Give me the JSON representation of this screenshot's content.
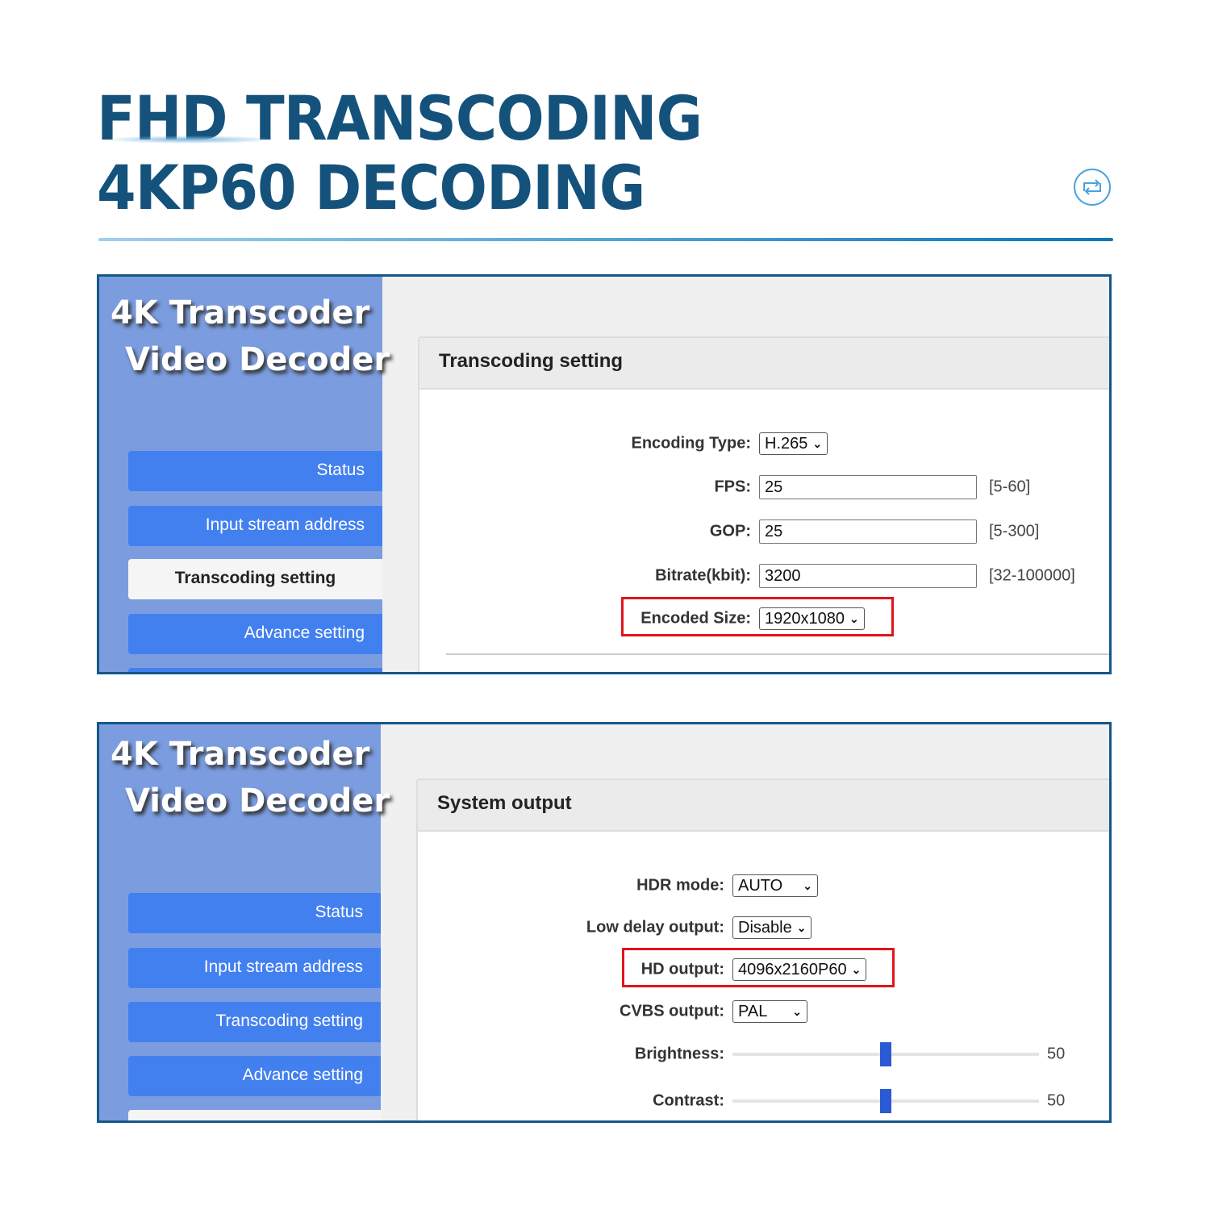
{
  "headline": {
    "line1": "FHD TRANSCODING",
    "line2": "4KP60 DECODING",
    "icon": "swap-arrows-icon",
    "accent": "#14527c"
  },
  "panel1": {
    "logo": {
      "line1": "4K Transcoder",
      "line2": "Video Decoder"
    },
    "nav": [
      "Status",
      "Input stream address",
      "Transcoding setting",
      "Advance setting"
    ],
    "active_nav": "Transcoding setting",
    "card_title": "Transcoding setting",
    "fields": {
      "encoding_type": {
        "label": "Encoding Type:",
        "value": "H.265"
      },
      "fps": {
        "label": "FPS:",
        "value": "25",
        "range": "[5-60]"
      },
      "gop": {
        "label": "GOP:",
        "value": "25",
        "range": "[5-300]"
      },
      "bitrate": {
        "label": "Bitrate(kbit):",
        "value": "3200",
        "range": "[32-100000]"
      },
      "encoded_size": {
        "label": "Encoded Size:",
        "value": "1920x1080"
      }
    }
  },
  "panel2": {
    "logo": {
      "line1": "4K Transcoder",
      "line2": "Video Decoder"
    },
    "nav": [
      "Status",
      "Input stream address",
      "Transcoding setting",
      "Advance setting"
    ],
    "card_title": "System output",
    "fields": {
      "hdr_mode": {
        "label": "HDR mode:",
        "value": "AUTO"
      },
      "low_delay": {
        "label": "Low delay output:",
        "value": "Disable"
      },
      "hd_output": {
        "label": "HD output:",
        "value": "4096x2160P60"
      },
      "cvbs_output": {
        "label": "CVBS output:",
        "value": "PAL"
      },
      "brightness": {
        "label": "Brightness:",
        "value": "50",
        "min": 0,
        "max": 100
      },
      "contrast": {
        "label": "Contrast:",
        "value": "50",
        "min": 0,
        "max": 100
      }
    }
  },
  "colors": {
    "highlight_box": "#e0141c",
    "sidebar": "#7b9de0",
    "nav_button": "#4380ef",
    "frame": "#15578a"
  }
}
